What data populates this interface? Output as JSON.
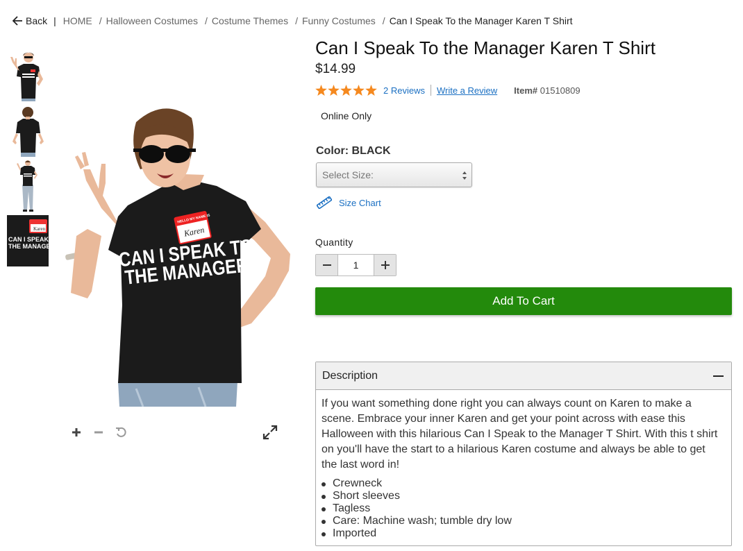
{
  "breadcrumb": {
    "back_label": "Back",
    "separator": "|",
    "items": [
      "HOME",
      "Halloween Costumes",
      "Costume Themes",
      "Funny Costumes"
    ],
    "current": "Can I Speak To the Manager Karen T Shirt"
  },
  "product": {
    "title": "Can I Speak To the Manager Karen T Shirt",
    "price": "$14.99",
    "rating": 5,
    "reviews_label": "2 Reviews",
    "write_review_label": "Write a Review",
    "item_label": "Item#",
    "item_number": "01510809",
    "availability": "Online Only",
    "color_label": "Color: BLACK",
    "size_placeholder": "Select Size:",
    "size_chart_label": "Size Chart",
    "quantity_label": "Quantity",
    "quantity_value": "1",
    "add_to_cart_label": "Add To Cart"
  },
  "image": {
    "shirt_text_line1": "CAN I SPEAK TO",
    "shirt_text_line2": "THE MANAGER?",
    "name_tag_header": "HELLO MY NAME IS",
    "name_tag_name": "Karen"
  },
  "description": {
    "heading": "Description",
    "paragraph": "If you want something done right you can always count on Karen to make a scene. Embrace your inner Karen and get your point across with ease this Halloween with this hilarious Can I Speak to the Manager T Shirt. With this t shirt on you'll have the start to a hilarious Karen costume and always be able to get the last word in!",
    "bullets": [
      "Crewneck",
      "Short sleeves",
      "Tagless",
      "Care: Machine wash; tumble dry low",
      "Imported"
    ]
  },
  "colors": {
    "star": "#f5891f",
    "link": "#1a6fc2",
    "cart_button": "#238a0c"
  }
}
